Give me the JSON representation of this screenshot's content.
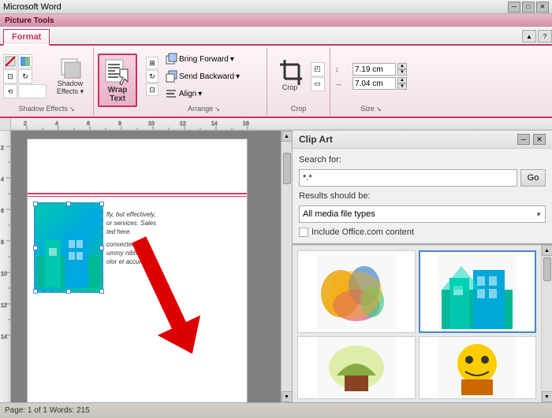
{
  "titleBar": {
    "title": "Microsoft Word",
    "minimizeLabel": "─",
    "maximizeLabel": "□",
    "closeLabel": "✕"
  },
  "pictureTool": {
    "bandLabel": "Picture Tools"
  },
  "ribbonTabs": {
    "active": "Format",
    "tabs": [
      "Format"
    ]
  },
  "groups": {
    "shadowEffects": {
      "label": "Shadow Effects",
      "expandIcon": "↘"
    },
    "arrange": {
      "label": "Arrange",
      "expandIcon": "↘",
      "bringForward": "Bring Forward",
      "sendBackward": "Send Backward",
      "align": "Align"
    },
    "crop": {
      "label": "Crop",
      "cropLabel": "Crop"
    },
    "size": {
      "label": "Size",
      "expandIcon": "↘",
      "width": "7.19 cm",
      "height": "7.04 cm"
    },
    "wrapText": {
      "label": "Wrap\nText"
    }
  },
  "clipArt": {
    "title": "Clip Art",
    "searchLabel": "Search for:",
    "searchValue": "*.*",
    "goButton": "Go",
    "resultsLabel": "Results should be:",
    "dropdownValue": "All media file types",
    "checkboxLabel": "Include Office.com content"
  },
  "document": {
    "content1": "fly, but effectively,",
    "content2": "or services. Sales",
    "content3": "ted here.",
    "content4": "consectetur",
    "content5": "ummy nibh euis",
    "content6": "olor et accumsan."
  },
  "statusBar": {
    "text": "Page: 1 of 1   Words: 215"
  }
}
